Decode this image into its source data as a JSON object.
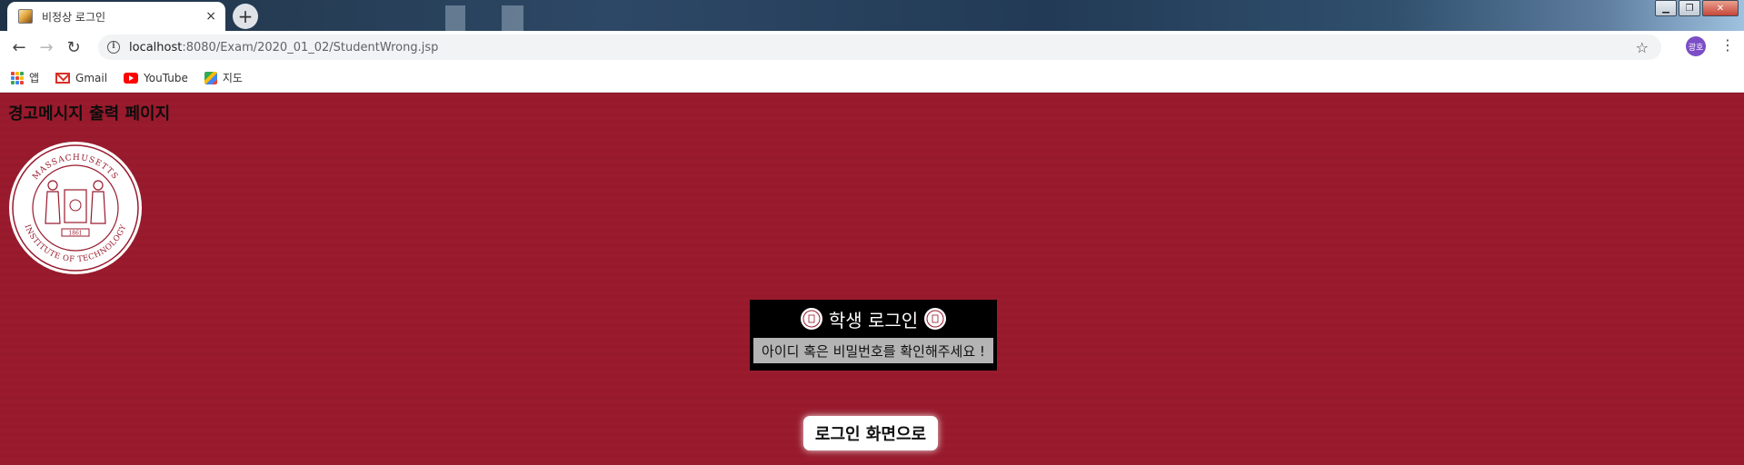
{
  "browser": {
    "tab_title": "비정상 로그인",
    "tab_close": "×",
    "new_tab": "+",
    "url_host": "localhost",
    "url_path": ":8080/Exam/2020_01_02/StudentWrong.jsp",
    "profile_initials": "광호"
  },
  "window_controls": {
    "minimize": "▁",
    "restore": "❐",
    "close": "✕"
  },
  "bookmarks": [
    {
      "label": "앱",
      "icon": "apps-icon"
    },
    {
      "label": "Gmail",
      "icon": "gmail-icon"
    },
    {
      "label": "YouTube",
      "icon": "youtube-icon"
    },
    {
      "label": "지도",
      "icon": "maps-icon"
    }
  ],
  "page": {
    "heading": "경고메시지 출력 페이지",
    "seal_alt": "Massachusetts Institute of Technology seal",
    "seal_text_top": "MASSACHUSETTS",
    "seal_text_bottom": "INSTITUTE OF TECHNOLOGY",
    "seal_year": "1861",
    "login_title": "학생 로그인",
    "warning": "아이디 혹은 비밀번호를 확인해주세요 !",
    "back_button": "로그인 화면으로"
  },
  "colors": {
    "page_background": "#981a2c",
    "login_box": "#000000",
    "warning_background": "#b4b4b4"
  }
}
